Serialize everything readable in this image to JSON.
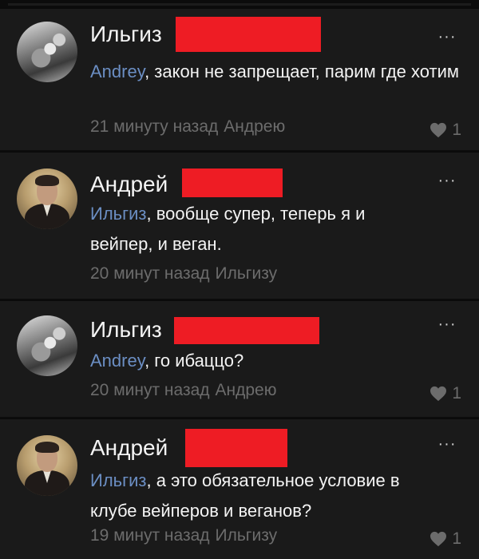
{
  "comments": [
    {
      "author": "Ильгиз",
      "mention": "Andrey",
      "text": ", закон не запрещает, парим где хотим",
      "time": "21 минуту назад",
      "reply_to": "Андрею",
      "likes": "1",
      "more_label": "···",
      "avatar_icon": "user-avatar-photo"
    },
    {
      "author": "Андрей",
      "mention": "Ильгиз",
      "text": ", вообще супер, теперь я и вейпер, и веган.",
      "time": "20 минут назад",
      "reply_to": "Ильгизу",
      "likes": "",
      "more_label": "···",
      "avatar_icon": "user-avatar-photo"
    },
    {
      "author": "Ильгиз",
      "mention": "Andrey",
      "text": ", го ибаццо?",
      "time": "20 минут назад",
      "reply_to": "Андрею",
      "likes": "1",
      "more_label": "···",
      "avatar_icon": "user-avatar-photo"
    },
    {
      "author": "Андрей",
      "mention": "Ильгиз",
      "text": ", а это обязательное условие в клубе вейперов и веганов?",
      "time": "19 минут назад",
      "reply_to": "Ильгизу",
      "likes": "1",
      "more_label": "···",
      "avatar_icon": "user-avatar-photo"
    }
  ],
  "colors": {
    "background": "#1a1a1a",
    "mention": "#6b8ec3",
    "meta": "#6c6c6c",
    "redaction": "#ee1c24"
  },
  "icons": {
    "like": "heart-icon",
    "more": "more-dots-icon"
  }
}
